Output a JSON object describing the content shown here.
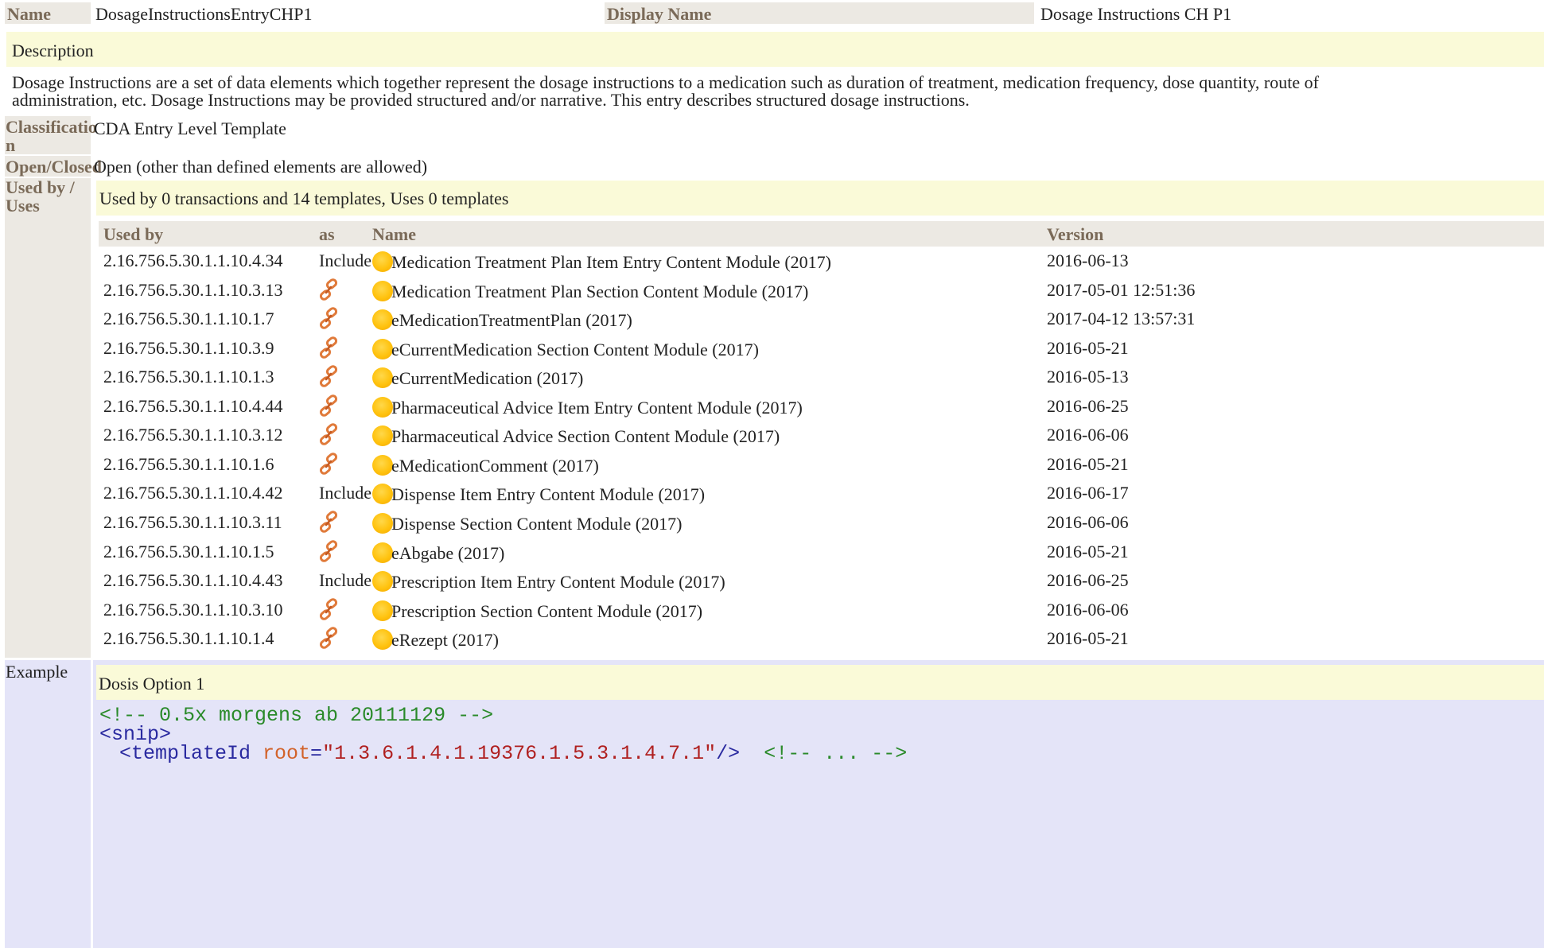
{
  "header": {
    "name_label": "Name",
    "name_value": "DosageInstructionsEntryCHP1",
    "display_name_label": "Display Name",
    "display_name_value": "Dosage Instructions CH P1"
  },
  "description": {
    "label": "Description",
    "line1": "Dosage Instructions are a set of data elements which together represent the dosage instructions to a medication such as duration of treatment, medication frequency, dose quantity, route of",
    "line2": "administration, etc. Dosage Instructions may be provided structured and/or narrative. This entry describes structured dosage instructions."
  },
  "classification": {
    "label_line1": "Classificatio",
    "label_line2": "n",
    "value": "CDA Entry Level Template"
  },
  "open_closed": {
    "label": "Open/Closed",
    "value": "Open (other than defined elements are allowed)"
  },
  "used_by": {
    "label_line1": "Used by /",
    "label_line2": "Uses",
    "summary": "Used by 0 transactions and 14 templates, Uses 0 templates",
    "columns": [
      "Used by",
      "as",
      "Name",
      "Version"
    ],
    "rows": [
      {
        "id": "2.16.756.5.30.1.1.10.4.34",
        "as": "Include",
        "name": "Medication Treatment Plan Item Entry Content Module (2017)",
        "version": "2016-06-13"
      },
      {
        "id": "2.16.756.5.30.1.1.10.3.13",
        "as": "link",
        "name": "Medication Treatment Plan Section Content Module (2017)",
        "version": "2017-05-01 12:51:36"
      },
      {
        "id": "2.16.756.5.30.1.1.10.1.7",
        "as": "link",
        "name": "eMedicationTreatmentPlan (2017)",
        "version": "2017-04-12 13:57:31"
      },
      {
        "id": "2.16.756.5.30.1.1.10.3.9",
        "as": "link",
        "name": "eCurrentMedication Section Content Module (2017)",
        "version": "2016-05-21"
      },
      {
        "id": "2.16.756.5.30.1.1.10.1.3",
        "as": "link",
        "name": "eCurrentMedication (2017)",
        "version": "2016-05-13"
      },
      {
        "id": "2.16.756.5.30.1.1.10.4.44",
        "as": "link",
        "name": "Pharmaceutical Advice Item Entry Content Module (2017)",
        "version": "2016-06-25"
      },
      {
        "id": "2.16.756.5.30.1.1.10.3.12",
        "as": "link",
        "name": "Pharmaceutical Advice Section Content Module (2017)",
        "version": "2016-06-06"
      },
      {
        "id": "2.16.756.5.30.1.1.10.1.6",
        "as": "link",
        "name": "eMedicationComment (2017)",
        "version": "2016-05-21"
      },
      {
        "id": "2.16.756.5.30.1.1.10.4.42",
        "as": "Include",
        "name": "Dispense Item Entry Content Module (2017)",
        "version": "2016-06-17"
      },
      {
        "id": "2.16.756.5.30.1.1.10.3.11",
        "as": "link",
        "name": "Dispense Section Content Module (2017)",
        "version": "2016-06-06"
      },
      {
        "id": "2.16.756.5.30.1.1.10.1.5",
        "as": "link",
        "name": "eAbgabe (2017)",
        "version": "2016-05-21"
      },
      {
        "id": "2.16.756.5.30.1.1.10.4.43",
        "as": "Include",
        "name": "Prescription Item Entry Content Module (2017)",
        "version": "2016-06-25"
      },
      {
        "id": "2.16.756.5.30.1.1.10.3.10",
        "as": "link",
        "name": "Prescription Section Content Module (2017)",
        "version": "2016-06-06"
      },
      {
        "id": "2.16.756.5.30.1.1.10.1.4",
        "as": "link",
        "name": "eRezept (2017)",
        "version": "2016-05-21"
      }
    ]
  },
  "example": {
    "label": "Example",
    "title": "Dosis Option 1",
    "code_comment1": "<!-- 0.5x morgens ab 20111129 -->",
    "code_snip": "<snip>",
    "code_tpl_open": "<templateId ",
    "code_tpl_attr": "root",
    "code_tpl_eq": "=",
    "code_tpl_val": "\"1.3.6.1.4.1.19376.1.5.3.1.4.7.1\"",
    "code_tpl_close": "/>",
    "code_tpl_comment": "<!-- ... -->"
  },
  "icons": {
    "status": "status-draft-circle-icon",
    "link": "chain-link-icon"
  },
  "colors": {
    "label_bg": "#ece9e3",
    "label_text": "#7a6a58",
    "yellow_bg": "#fafad8",
    "example_bg": "#e4e4f8"
  }
}
